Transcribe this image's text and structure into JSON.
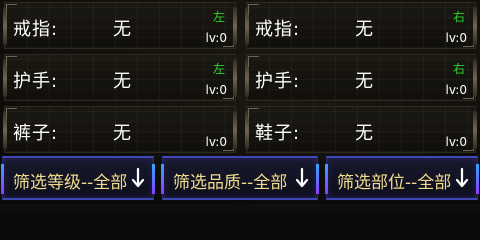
{
  "slots": [
    {
      "label": "戒指:",
      "value": "无",
      "side": "左",
      "level": "lv:0"
    },
    {
      "label": "戒指:",
      "value": "无",
      "side": "右",
      "level": "lv:0"
    },
    {
      "label": "护手:",
      "value": "无",
      "side": "左",
      "level": "lv:0"
    },
    {
      "label": "护手:",
      "value": "无",
      "side": "右",
      "level": "lv:0"
    },
    {
      "label": "裤子:",
      "value": "无",
      "side": "",
      "level": "lv:0"
    },
    {
      "label": "鞋子:",
      "value": "无",
      "side": "",
      "level": "lv:0"
    }
  ],
  "filters": [
    {
      "label": "筛选等级--全部",
      "icon": "down-arrow-icon"
    },
    {
      "label": "筛选品质--全部",
      "icon": "down-arrow-icon"
    },
    {
      "label": "筛选部位--全部",
      "icon": "down-arrow-icon"
    }
  ],
  "colors": {
    "side_tag": "#2fd12f",
    "filter_text": "#f1dc8e",
    "filter_border": "#3e47b6"
  }
}
